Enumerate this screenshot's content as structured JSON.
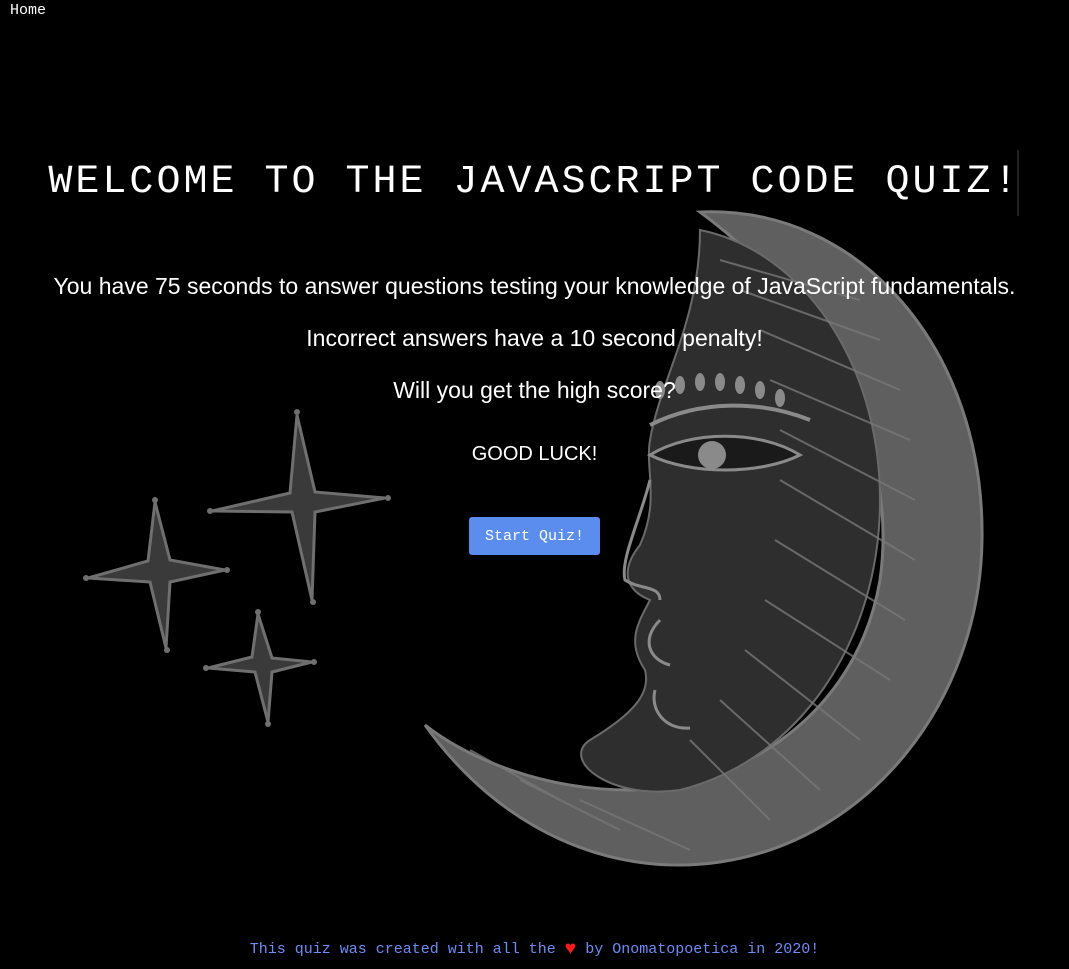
{
  "nav": {
    "home_label": "Home"
  },
  "header": {
    "title": "WELCOME TO THE JAVASCRIPT CODE QUIZ!"
  },
  "intro": {
    "line1": "You have 75 seconds to answer questions testing your knowledge of JavaScript fundamentals.",
    "line2": "Incorrect answers have a 10 second penalty!",
    "line3": "Will you get the high score?",
    "good_luck": "GOOD LUCK!"
  },
  "actions": {
    "start_label": "Start Quiz!"
  },
  "footer": {
    "prefix": "This quiz was created with all the",
    "heart_glyph": "♥",
    "suffix": "by Onomatopoetica in 2020!"
  },
  "colors": {
    "background": "#000000",
    "button": "#5b8def",
    "footer_text": "#6e8cf7",
    "heart": "#ff1a1a",
    "art": "#6b6b6b"
  },
  "icons": {
    "background_art": "crescent-moon-face-illustration",
    "stars": "four-point-stars-illustration"
  }
}
